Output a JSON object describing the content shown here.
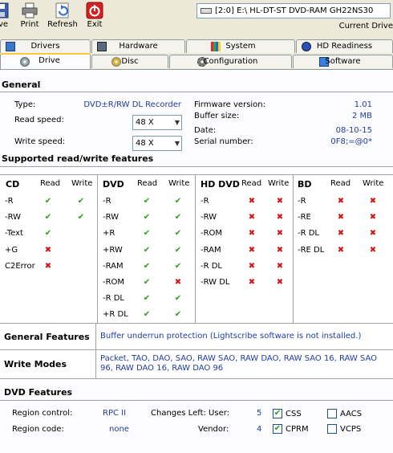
{
  "toolbar": {
    "save_label": "ave",
    "print_label": "Print",
    "refresh_label": "Refresh",
    "exit_label": "Exit"
  },
  "drive": {
    "selected": "[2:0] E:\\ HL-DT-ST DVD-RAM GH22NS30",
    "current_label": "Current Drive"
  },
  "tabs": {
    "top": [
      "Drivers",
      "Hardware",
      "System",
      "HD Readiness"
    ],
    "bottom": [
      "Drive",
      "Disc",
      "Configuration",
      "Software"
    ],
    "active": "Drive"
  },
  "general": {
    "title": "General",
    "type_label": "Type:",
    "type_value": "DVD±R/RW DL Recorder",
    "read_speed_label": "Read speed:",
    "read_speed_value": "48 X",
    "write_speed_label": "Write speed:",
    "write_speed_value": "48 X",
    "firmware_label": "Firmware version:",
    "firmware_value": "1.01",
    "buffer_label": "Buffer size:",
    "buffer_value": "2 MB",
    "date_label": "Date:",
    "date_value": "08-10-15",
    "serial_label": "Serial number:",
    "serial_value": "0F8;=@0*"
  },
  "features": {
    "title": "Supported read/write features",
    "read_label": "Read",
    "write_label": "Write",
    "groups": [
      {
        "name": "CD",
        "rows": [
          {
            "label": "-R",
            "read": "yes",
            "write": "yes"
          },
          {
            "label": "-RW",
            "read": "yes",
            "write": "yes"
          },
          {
            "label": "-Text",
            "read": "yes",
            "write": "none"
          },
          {
            "label": "+G",
            "read": "no",
            "write": "none"
          },
          {
            "label": "C2Error",
            "read": "no",
            "write": "none"
          }
        ]
      },
      {
        "name": "DVD",
        "rows": [
          {
            "label": "-R",
            "read": "yes",
            "write": "yes"
          },
          {
            "label": "-RW",
            "read": "yes",
            "write": "yes"
          },
          {
            "label": "+R",
            "read": "yes",
            "write": "yes"
          },
          {
            "label": "+RW",
            "read": "yes",
            "write": "yes"
          },
          {
            "label": "-RAM",
            "read": "yes",
            "write": "yes"
          },
          {
            "label": "-ROM",
            "read": "yes",
            "write": "no"
          },
          {
            "label": "-R DL",
            "read": "yes",
            "write": "yes"
          },
          {
            "label": "+R DL",
            "read": "yes",
            "write": "yes"
          }
        ]
      },
      {
        "name": "HD DVD",
        "rows": [
          {
            "label": "-R",
            "read": "no",
            "write": "no"
          },
          {
            "label": "-RW",
            "read": "no",
            "write": "no"
          },
          {
            "label": "-ROM",
            "read": "no",
            "write": "no"
          },
          {
            "label": "-RAM",
            "read": "no",
            "write": "no"
          },
          {
            "label": "-R DL",
            "read": "no",
            "write": "no"
          },
          {
            "label": "-RW DL",
            "read": "no",
            "write": "no"
          }
        ]
      },
      {
        "name": "BD",
        "rows": [
          {
            "label": "-R",
            "read": "no",
            "write": "no"
          },
          {
            "label": "-RE",
            "read": "no",
            "write": "no"
          },
          {
            "label": "-R DL",
            "read": "no",
            "write": "no"
          },
          {
            "label": "-RE DL",
            "read": "no",
            "write": "no"
          }
        ]
      }
    ]
  },
  "general_features": {
    "label": "General Features",
    "value": "Buffer underrun protection (Lightscribe software is not installed.)"
  },
  "write_modes": {
    "label": "Write Modes",
    "value": "Packet, TAO, DAO, SAO, RAW SAO, RAW DAO, RAW SAO 16, RAW SAO 96, RAW DAO 16, RAW DAO 96"
  },
  "dvd_features": {
    "title": "DVD Features",
    "region_control_label": "Region control:",
    "region_control_value": "RPC II",
    "region_code_label": "Region code:",
    "region_code_value": "none",
    "changes_user_label": "Changes Left: User:",
    "changes_user_value": "5",
    "vendor_label": "Vendor:",
    "vendor_value": "4",
    "checkboxes": [
      {
        "label": "CSS",
        "checked": true
      },
      {
        "label": "AACS",
        "checked": false
      },
      {
        "label": "CPRM",
        "checked": true
      },
      {
        "label": "VCPS",
        "checked": false
      }
    ]
  },
  "colors": {
    "ok": "#2aa01a",
    "no": "#d21414",
    "value_text": "#1e3ca0"
  }
}
